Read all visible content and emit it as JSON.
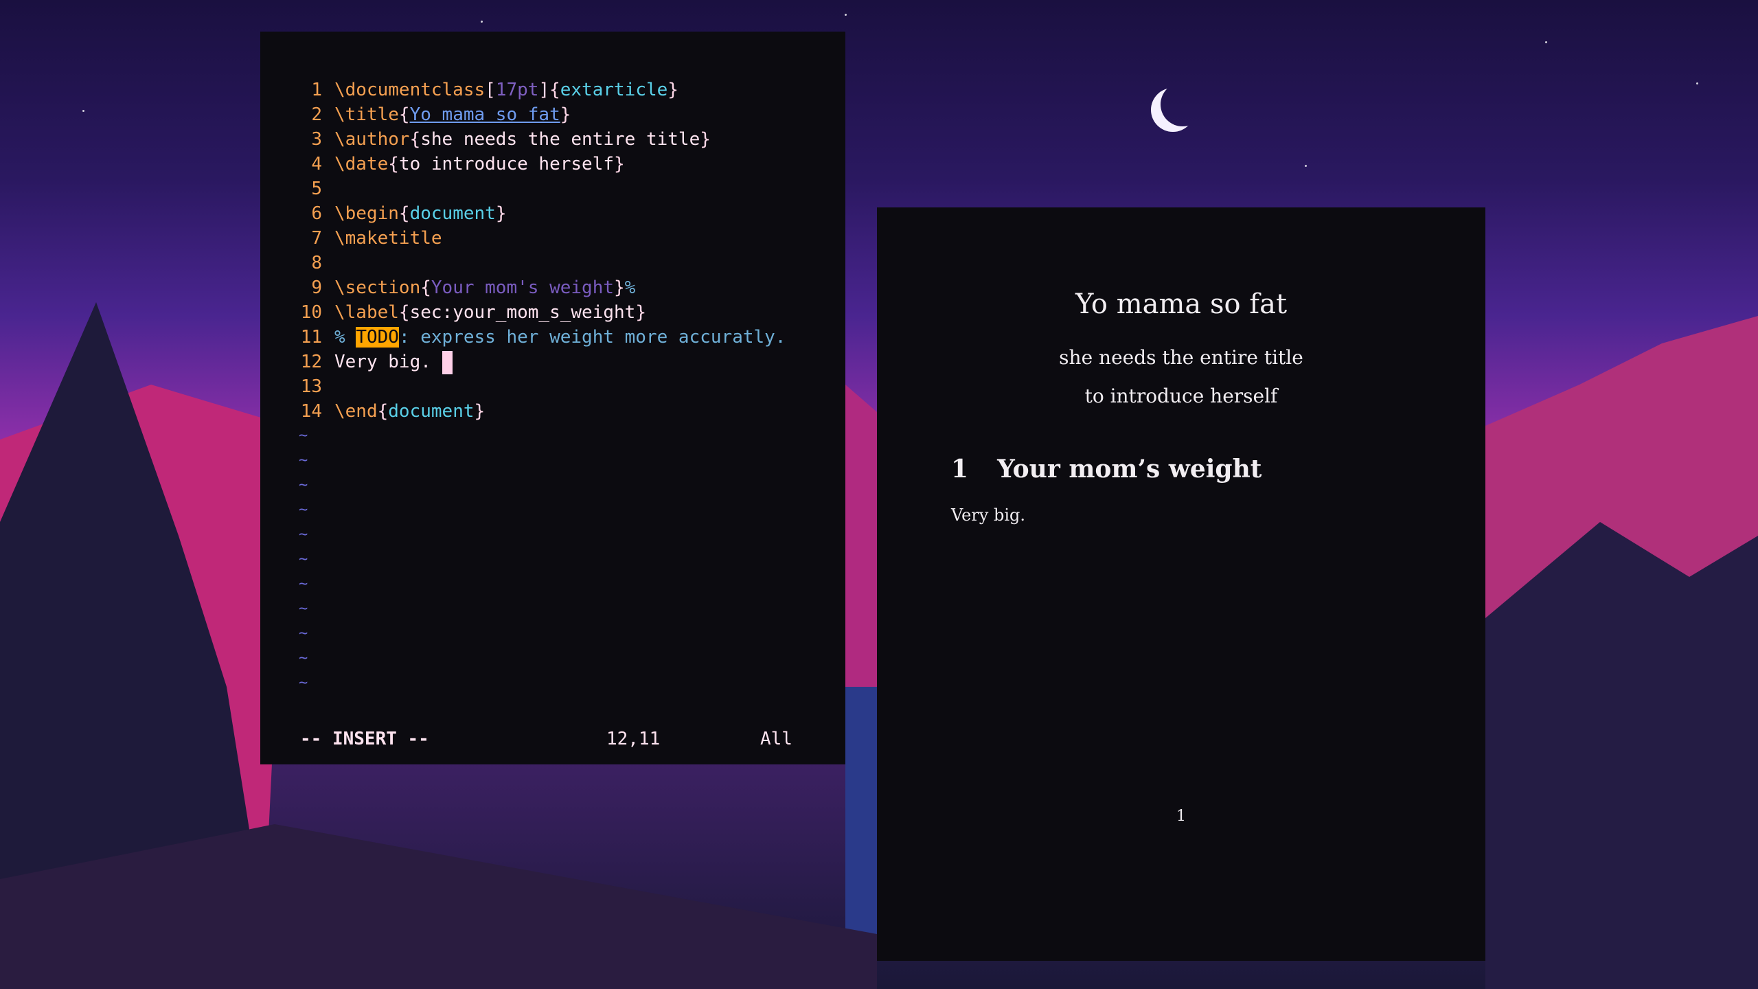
{
  "editor": {
    "lines": [
      {
        "n": "1",
        "segs": [
          [
            "cmd",
            "\\documentclass"
          ],
          [
            "brace",
            "["
          ],
          [
            "opt",
            "17pt"
          ],
          [
            "brace",
            "]{"
          ],
          [
            "arg",
            "extarticle"
          ],
          [
            "brace",
            "}"
          ]
        ]
      },
      {
        "n": "2",
        "segs": [
          [
            "cmd",
            "\\title"
          ],
          [
            "brace",
            "{"
          ],
          [
            "title",
            "Yo mama so fat"
          ],
          [
            "brace",
            "}"
          ]
        ]
      },
      {
        "n": "3",
        "segs": [
          [
            "cmd",
            "\\author"
          ],
          [
            "brace",
            "{"
          ],
          [
            "text",
            "she needs the entire title"
          ],
          [
            "brace",
            "}"
          ]
        ]
      },
      {
        "n": "4",
        "segs": [
          [
            "cmd",
            "\\date"
          ],
          [
            "brace",
            "{"
          ],
          [
            "text",
            "to introduce herself"
          ],
          [
            "brace",
            "}"
          ]
        ]
      },
      {
        "n": "5",
        "segs": []
      },
      {
        "n": "6",
        "segs": [
          [
            "cmd",
            "\\begin"
          ],
          [
            "brace",
            "{"
          ],
          [
            "arg",
            "document"
          ],
          [
            "brace",
            "}"
          ]
        ]
      },
      {
        "n": "7",
        "segs": [
          [
            "cmd",
            "\\maketitle"
          ]
        ]
      },
      {
        "n": "8",
        "segs": []
      },
      {
        "n": "9",
        "segs": [
          [
            "cmd",
            "\\section"
          ],
          [
            "brace",
            "{"
          ],
          [
            "sec",
            "Your mom's weight"
          ],
          [
            "brace",
            "}"
          ],
          [
            "com",
            "%"
          ]
        ]
      },
      {
        "n": "10",
        "segs": [
          [
            "cmd",
            "\\label"
          ],
          [
            "brace",
            "{"
          ],
          [
            "text",
            "sec:your_mom_s_weight"
          ],
          [
            "brace",
            "}"
          ]
        ]
      },
      {
        "n": "11",
        "segs": [
          [
            "com",
            "% "
          ],
          [
            "todo",
            "TODO"
          ],
          [
            "com",
            ": express her weight more accuratly."
          ]
        ]
      },
      {
        "n": "12",
        "segs": [
          [
            "text",
            "Very big. "
          ]
        ],
        "cursor": true
      },
      {
        "n": "13",
        "segs": []
      },
      {
        "n": "14",
        "segs": [
          [
            "cmd",
            "\\end"
          ],
          [
            "brace",
            "{"
          ],
          [
            "arg",
            "document"
          ],
          [
            "brace",
            "}"
          ]
        ]
      }
    ],
    "tilde_count": 11,
    "tilde": "~",
    "status": {
      "mode": "-- INSERT --",
      "position": "12,11",
      "scroll": "All"
    }
  },
  "pdf": {
    "title": "Yo mama so fat",
    "author": "she needs the entire title",
    "date": "to introduce herself",
    "section_number": "1",
    "section_title": "Your mom’s weight",
    "body": "Very big.",
    "page_number": "1"
  },
  "colors": {
    "accent_orange": "#f5a051",
    "todo_bg": "#ffa500",
    "window_bg": "#0c0b10"
  }
}
